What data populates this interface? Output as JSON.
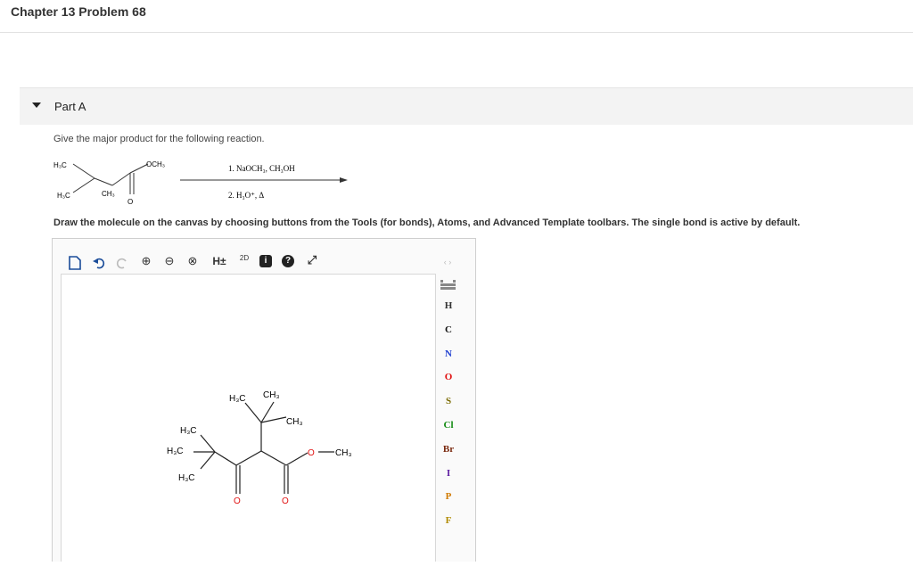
{
  "header": {
    "title": "Chapter 13 Problem 68"
  },
  "part": {
    "label": "Part A"
  },
  "question": {
    "prompt": "Give the major product for the following reaction."
  },
  "reaction": {
    "reagent_1": "1. NaOCH₃, CH₃OH",
    "reagent_2": "2. H₃O⁺, Δ",
    "reactant_labels": {
      "h3c_top": "H₃C",
      "och3": "OCH₃",
      "h3c_bottom": "H₃C",
      "ch3": "CH₃",
      "carbonyl_o": "O"
    }
  },
  "instruction": "Draw the molecule on the canvas by choosing buttons from the Tools (for bonds), Atoms, and Advanced Template toolbars. The single bond is active by default.",
  "toolbar": {
    "zoom_in": "⊕",
    "zoom_out": "⊖",
    "clear": "⊗",
    "hydrogen": "H±",
    "dim": "2D",
    "info": "i",
    "help": "?",
    "expand": "⤢"
  },
  "left_tools": {
    "charge_plus": "+",
    "charge_minus": "-"
  },
  "atoms": [
    {
      "symbol": "H",
      "color": "#333333"
    },
    {
      "symbol": "C",
      "color": "#111111"
    },
    {
      "symbol": "N",
      "color": "#1f3fd0"
    },
    {
      "symbol": "O",
      "color": "#e01010"
    },
    {
      "symbol": "S",
      "color": "#7a6a00"
    },
    {
      "symbol": "Cl",
      "color": "#118a11"
    },
    {
      "symbol": "Br",
      "color": "#7a2a10"
    },
    {
      "symbol": "I",
      "color": "#5b1aa0"
    },
    {
      "symbol": "P",
      "color": "#d07a00"
    },
    {
      "symbol": "F",
      "color": "#b08a00"
    }
  ],
  "molecule_labels": {
    "h3c_a": "H₃C",
    "ch3_a": "CH₃",
    "ch3_b": "CH₃",
    "h3c_b": "H₃C",
    "h3c_c": "H₃C",
    "h3c_d": "H₃C",
    "o_ester": "O",
    "ch3_ester": "CH₃",
    "o_ketone": "O",
    "o_ester_dbl": "O"
  }
}
